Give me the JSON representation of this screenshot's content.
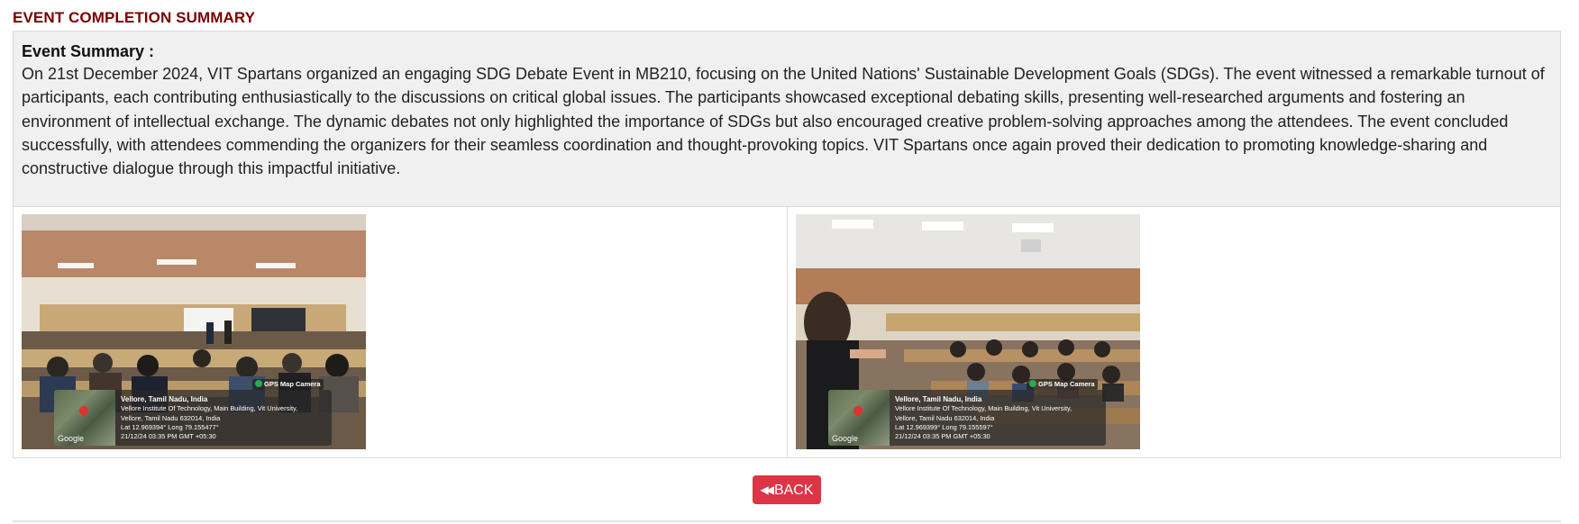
{
  "section_title": "EVENT COMPLETION SUMMARY",
  "summary": {
    "heading": "Event Summary :",
    "text": "On 21st December 2024, VIT Spartans organized an engaging SDG Debate Event in MB210, focusing on the United Nations' Sustainable Development Goals (SDGs). The event witnessed a remarkable turnout of participants, each contributing enthusiastically to the discussions on critical global issues. The participants showcased exceptional debating skills, presenting well-researched arguments and fostering an environment of intellectual exchange. The dynamic debates not only highlighted the importance of SDGs but also encouraged creative problem-solving approaches among the attendees. The event concluded successfully, with attendees commending the organizers for their seamless coordination and thought-provoking topics. VIT Spartans once again proved their dedication to promoting knowledge-sharing and constructive dialogue through this impactful initiative."
  },
  "photos": [
    {
      "badge": "GPS Map Camera",
      "location": "Vellore, Tamil Nadu, India",
      "address_1": "Vellore Institute Of Technology, Main Building, Vit University,",
      "address_2": "Vellore, Tamil Nadu 632014, India",
      "coords": "Lat 12.969394° Long 79.155477°",
      "timestamp": "21/12/24 03:35 PM GMT +05:30",
      "map_credit": "Google"
    },
    {
      "badge": "GPS Map Camera",
      "location": "Vellore, Tamil Nadu, India",
      "address_1": "Vellore Institute Of Technology, Main Building, Vit University,",
      "address_2": "Vellore, Tamil Nadu 632014, India",
      "coords": "Lat 12.969399° Long 79.155597°",
      "timestamp": "21/12/24 03:35 PM GMT +05:30",
      "map_credit": "Google"
    }
  ],
  "back_button": {
    "label": "BACK",
    "icon": "double-chevron-left-icon",
    "color": "#dc3545"
  },
  "colors": {
    "title": "#7a0000",
    "summary_bg": "#f0f0f0"
  }
}
